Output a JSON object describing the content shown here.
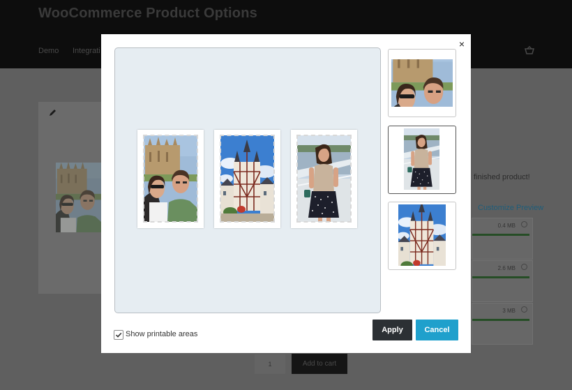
{
  "site": {
    "title": "WooCommerce Product Options",
    "nav": [
      "Demo",
      "Integrati"
    ]
  },
  "background": {
    "tagline_fragment": "finished product!",
    "customize_link": "Customize Preview",
    "uploads": [
      {
        "size": "0.4 MB"
      },
      {
        "size": "2.6 MB"
      },
      {
        "size": "3 MB"
      }
    ],
    "quantity": "1",
    "add_to_cart": "Add to cart"
  },
  "modal": {
    "close_label": "×",
    "show_printable_areas": {
      "label": "Show printable areas",
      "checked": true
    },
    "apply_label": "Apply",
    "cancel_label": "Cancel",
    "prints": [
      {
        "subject": "couple-selfie-cathedral"
      },
      {
        "subject": "timber-tower-house"
      },
      {
        "subject": "woman-on-boat"
      }
    ],
    "thumbnails": [
      {
        "subject": "couple-selfie-cathedral",
        "selected": false
      },
      {
        "subject": "woman-on-boat",
        "selected": true
      },
      {
        "subject": "timber-tower-house",
        "selected": false
      }
    ]
  },
  "colors": {
    "apply": "#2c3034",
    "cancel": "#1fa0cc",
    "canvas": "#e6edf2"
  }
}
